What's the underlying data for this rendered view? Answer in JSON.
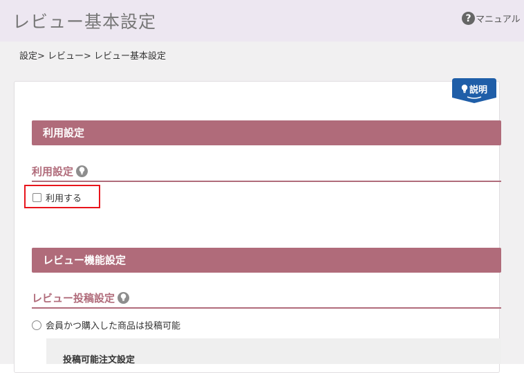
{
  "header": {
    "title": "レビュー基本設定",
    "manual": {
      "icon": "help-circle-icon",
      "label": "マニュアル"
    }
  },
  "breadcrumb": "設定> レビュー> レビュー基本設定",
  "explain_button": {
    "icon": "lightbulb-icon",
    "label": "説明"
  },
  "sections": {
    "usage": {
      "bar_label": "利用設定",
      "heading": "利用設定",
      "heading_icon": "lightbulb-icon",
      "checkbox_label": "利用する",
      "checkbox_checked": false
    },
    "review_function": {
      "bar_label": "レビュー機能設定",
      "heading": "レビュー投稿設定",
      "heading_icon": "lightbulb-icon",
      "radio_label": "会員かつ購入した商品は投稿可能",
      "radio_selected": false,
      "panel_title": "投稿可能注文設定"
    }
  },
  "colors": {
    "header_bg": "#ede7f1",
    "section_bar": "#b06b7a",
    "badge": "#1f5ea8",
    "highlight": "#e8141b"
  }
}
